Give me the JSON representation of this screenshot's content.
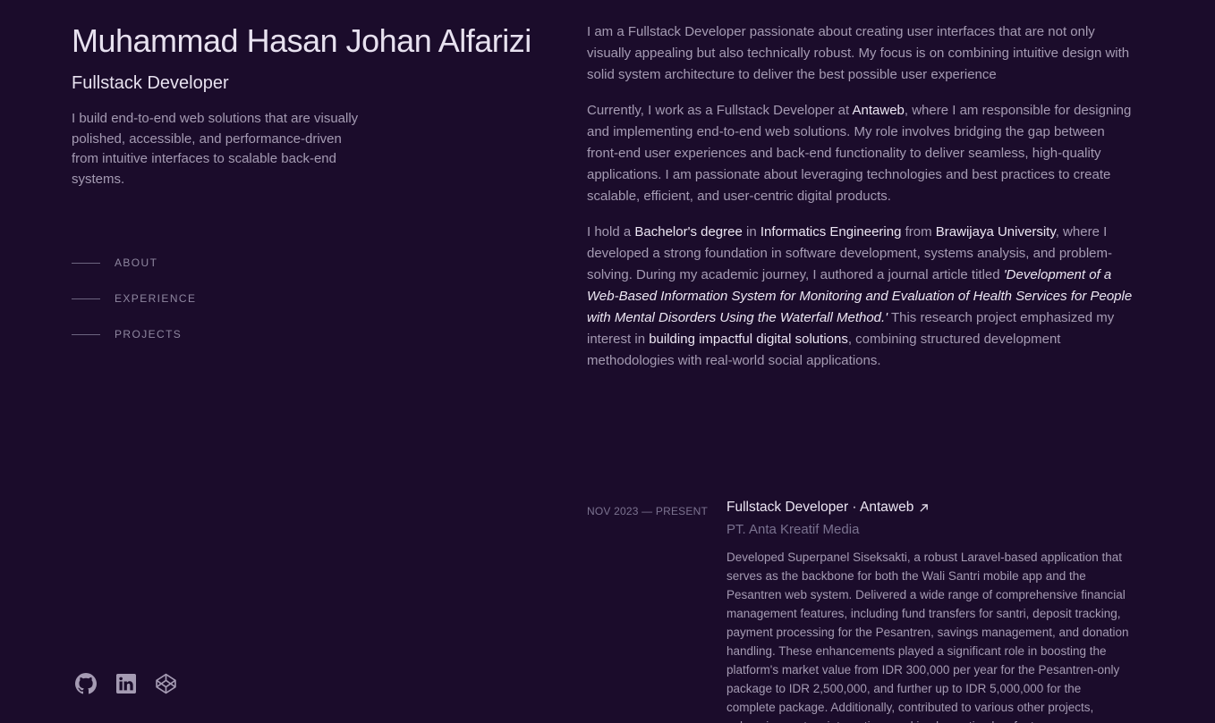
{
  "header": {
    "name": "Muhammad Hasan Johan Alfarizi",
    "role": "Fullstack Developer",
    "tagline": "I build end-to-end web solutions that are visually polished, accessible, and performance-driven from intuitive interfaces to scalable back-end systems."
  },
  "nav": {
    "items": [
      {
        "label": "ABOUT"
      },
      {
        "label": "EXPERIENCE"
      },
      {
        "label": "PROJECTS"
      }
    ]
  },
  "socials": {
    "icons": [
      "github-icon",
      "linkedin-icon",
      "codepen-icon"
    ]
  },
  "about": {
    "p1": "I am a Fullstack Developer passionate about creating user interfaces that are not only visually appealing but also technically robust. My focus is on combining intuitive design with solid system architecture to deliver the best possible user experience",
    "p2": {
      "t1": "Currently, I work as a Fullstack Developer at ",
      "company": "Antaweb",
      "t2": ", where I am responsible for designing and implementing end-to-end web solutions. My role involves bridging the gap between front-end user experiences and back-end functionality to deliver seamless, high-quality applications. I am passionate about leveraging technologies and best practices to create scalable, efficient, and user-centric digital products."
    },
    "p3": {
      "t1": "I hold a ",
      "degree": "Bachelor's degree",
      "t2": " in ",
      "major": "Informatics Engineering",
      "t3": " from ",
      "university": "Brawijaya University",
      "t4": ", where I developed a strong foundation in software development, systems analysis, and problem-solving. During my academic journey, I authored a journal article titled ",
      "journal": "'Development of a Web-Based Information System for Monitoring and Evaluation of Health Services for People with Mental Disorders Using the Waterfall Method.'",
      "t5": " This research project emphasized my interest in ",
      "interest": "building impactful digital solutions",
      "t6": ", combining structured development methodologies with real-world social applications."
    }
  },
  "experience": {
    "items": [
      {
        "date": "NOV 2023 — PRESENT",
        "title": "Fullstack Developer · Antaweb",
        "company": "PT. Anta Kreatif Media",
        "description": "Developed Superpanel Siseksakti, a robust Laravel-based application that serves as the backbone for both the Wali Santri mobile app and the Pesantren web system. Delivered a wide range of comprehensive financial management features, including fund transfers for santri, deposit tracking, payment processing for the Pesantren, savings management, and donation handling. These enhancements played a significant role in boosting the platform's market value from IDR 300,000 per year for the Pesantren-only package to IDR 2,500,000, and further up to IDR 5,000,000 for the complete package. Additionally, contributed to various other projects, enhancing system integrations and implementing key features."
      }
    ]
  },
  "colors": {
    "background": "#1b0c2b",
    "heading": "#e7e1ef",
    "body": "#a59bb3",
    "muted": "#7a7290"
  }
}
